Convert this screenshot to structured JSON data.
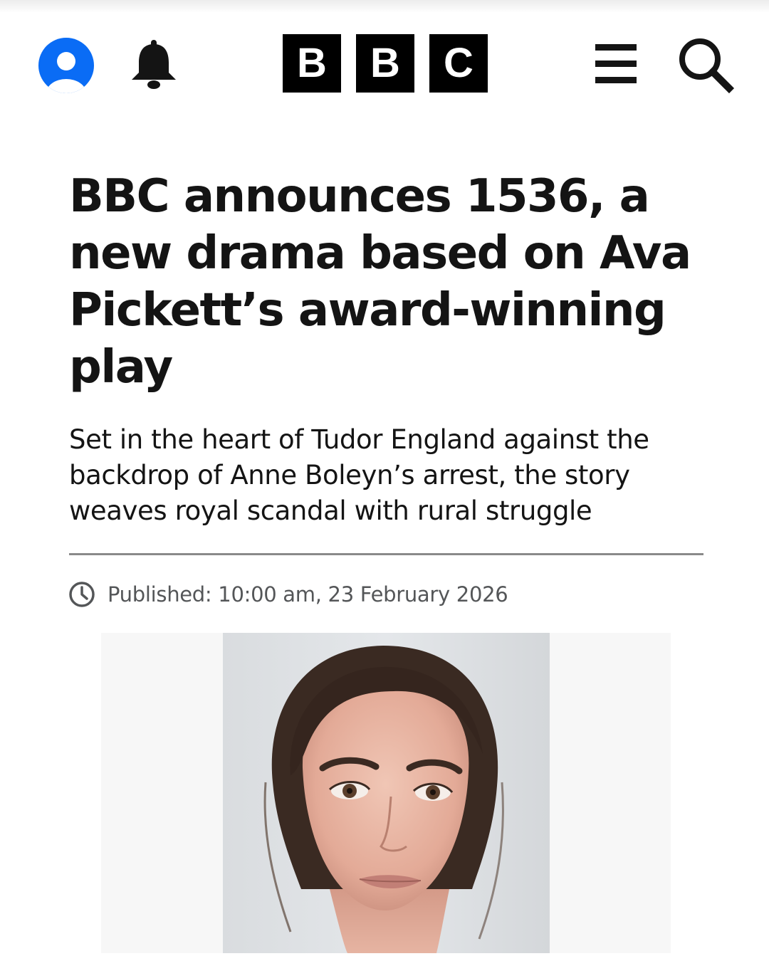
{
  "header": {
    "logo": [
      "B",
      "B",
      "C"
    ],
    "icons": {
      "account": "account-icon",
      "notifications": "bell-icon",
      "menu": "menu-icon",
      "search": "search-icon"
    },
    "colors": {
      "account_blue": "#0a6cf5",
      "logo_black": "#000000"
    }
  },
  "article": {
    "headline": "BBC announces 1536, a new drama based on Ava Pickett’s award-winning play",
    "standfirst": "Set in the heart of Tudor England against the backdrop of Anne Boleyn’s arrest, the story weaves royal scandal with rural struggle",
    "published": "Published: 10:00 am, 23 February 2026",
    "image_icon": "portrait-photo"
  }
}
